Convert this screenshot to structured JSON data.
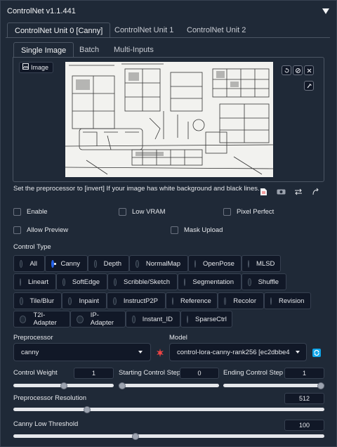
{
  "header": {
    "title": "ControlNet v1.1.441"
  },
  "unit_tabs": [
    {
      "label": "ControlNet Unit 0 [Canny]"
    },
    {
      "label": "ControlNet Unit 1"
    },
    {
      "label": "ControlNet Unit 2"
    }
  ],
  "image_tabs": [
    {
      "label": "Single Image"
    },
    {
      "label": "Batch"
    },
    {
      "label": "Multi-Inputs"
    }
  ],
  "image_label": "Image",
  "hint": "Set the preprocessor to [invert] If your image has white background and black lines.",
  "checkboxes": {
    "enable": "Enable",
    "low_vram": "Low VRAM",
    "pixel_perfect": "Pixel Perfect",
    "allow_preview": "Allow Preview",
    "mask_upload": "Mask Upload"
  },
  "control_type": {
    "label": "Control Type",
    "selected": "Canny",
    "options": [
      "All",
      "Canny",
      "Depth",
      "NormalMap",
      "OpenPose",
      "MLSD",
      "Lineart",
      "SoftEdge",
      "Scribble/Sketch",
      "Segmentation",
      "Shuffle",
      "Tile/Blur",
      "Inpaint",
      "InstructP2P",
      "Reference",
      "Recolor",
      "Revision",
      "T2I-Adapter",
      "IP-Adapter",
      "Instant_ID",
      "SparseCtrl"
    ]
  },
  "preprocessor": {
    "label": "Preprocessor",
    "value": "canny"
  },
  "model": {
    "label": "Model",
    "value": "control-lora-canny-rank256 [ec2dbbe4"
  },
  "sliders": {
    "control_weight": {
      "label": "Control Weight",
      "value": "1",
      "fraction": 0.5
    },
    "start_step": {
      "label": "Starting Control Step",
      "value": "0",
      "fraction": 0.0
    },
    "end_step": {
      "label": "Ending Control Step",
      "value": "1",
      "fraction": 1.0
    },
    "preprocessor_resolution": {
      "label": "Preprocessor Resolution",
      "value": "512",
      "fraction": 0.23
    },
    "canny_low": {
      "label": "Canny Low Threshold",
      "value": "100",
      "fraction": 0.39
    }
  },
  "colors": {
    "accent": "#2563eb",
    "panel": "#1f2937",
    "background": "#0b0f19"
  }
}
